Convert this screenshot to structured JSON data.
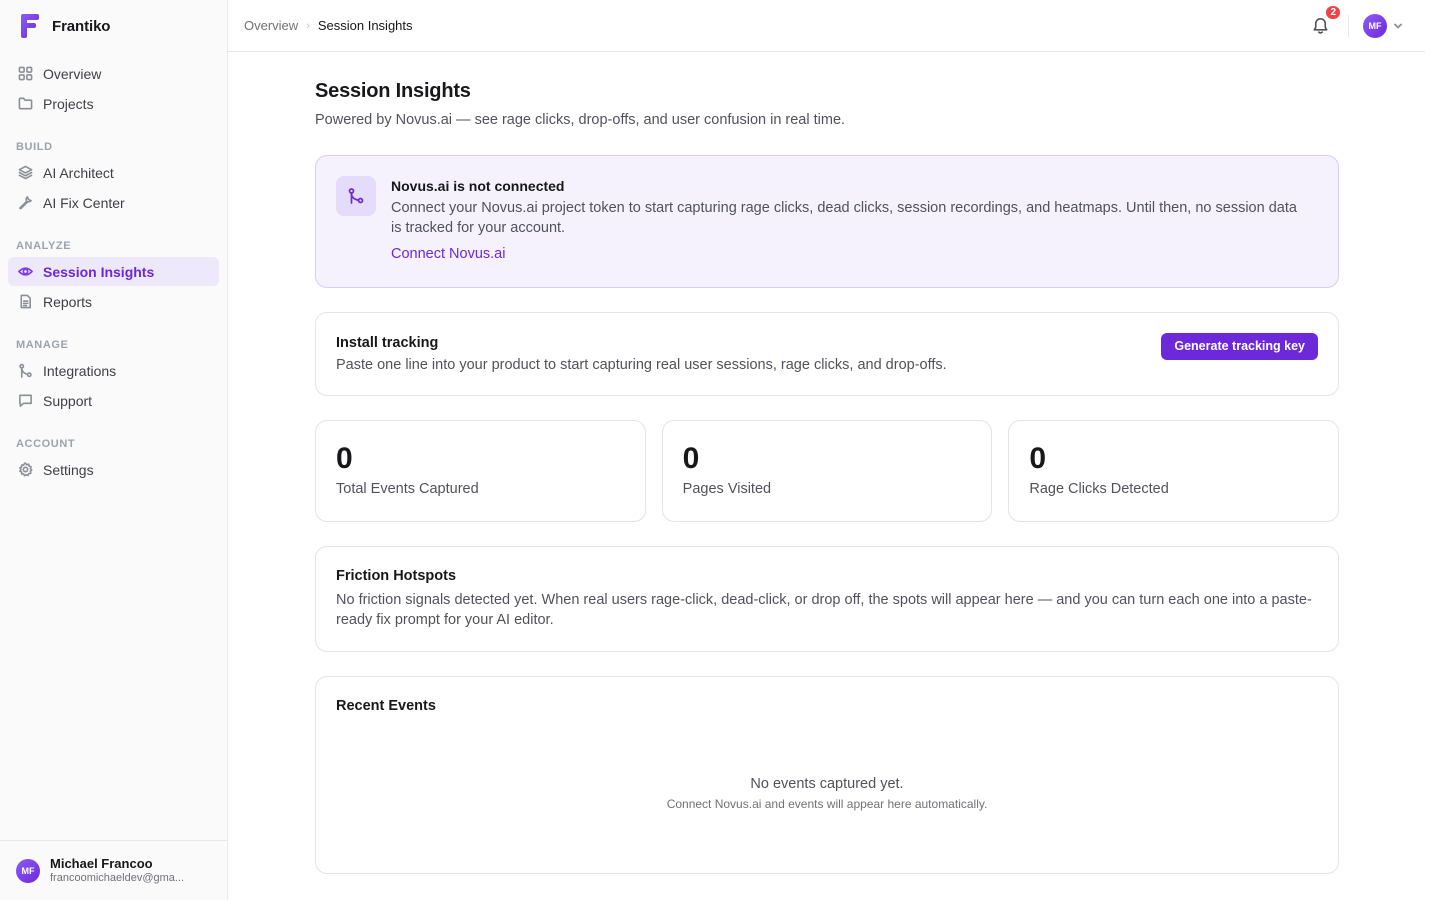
{
  "brand": {
    "name": "Frantiko",
    "logo_color": "#6d28d9"
  },
  "sidebar": {
    "top_items": [
      {
        "label": "Overview",
        "icon": "grid-icon"
      },
      {
        "label": "Projects",
        "icon": "folder-icon"
      }
    ],
    "sections": [
      {
        "label": "BUILD",
        "items": [
          {
            "label": "AI Architect",
            "icon": "layers-icon"
          },
          {
            "label": "AI Fix Center",
            "icon": "wrench-icon"
          }
        ]
      },
      {
        "label": "ANALYZE",
        "items": [
          {
            "label": "Session Insights",
            "icon": "eye-icon",
            "active": true
          },
          {
            "label": "Reports",
            "icon": "document-icon"
          }
        ]
      },
      {
        "label": "MANAGE",
        "items": [
          {
            "label": "Integrations",
            "icon": "git-merge-icon"
          },
          {
            "label": "Support",
            "icon": "chat-icon"
          }
        ]
      },
      {
        "label": "ACCOUNT",
        "items": [
          {
            "label": "Settings",
            "icon": "gear-icon"
          }
        ]
      }
    ],
    "user": {
      "initials": "MF",
      "name": "Michael Francoo",
      "email": "francoomichaeldev@gma..."
    }
  },
  "topbar": {
    "breadcrumb": [
      "Overview",
      "Session Insights"
    ],
    "notifications_count": "2",
    "avatar_initials": "MF"
  },
  "page": {
    "title": "Session Insights",
    "subtitle": "Powered by Novus.ai — see rage clicks, drop-offs, and user confusion in real time."
  },
  "alert": {
    "title": "Novus.ai is not connected",
    "text": "Connect your Novus.ai project token to start capturing rage clicks, dead clicks, session recordings, and heatmaps. Until then, no session data is tracked for your account.",
    "link": "Connect Novus.ai"
  },
  "install": {
    "title": "Install tracking",
    "text": "Paste one line into your product to start capturing real user sessions, rage clicks, and drop-offs.",
    "button": "Generate tracking key"
  },
  "stats": [
    {
      "value": "0",
      "label": "Total Events Captured"
    },
    {
      "value": "0",
      "label": "Pages Visited"
    },
    {
      "value": "0",
      "label": "Rage Clicks Detected"
    }
  ],
  "friction": {
    "title": "Friction Hotspots",
    "text": "No friction signals detected yet. When real users rage-click, dead-click, or drop off, the spots will appear here — and you can turn each one into a paste-ready fix prompt for your AI editor."
  },
  "recent": {
    "title": "Recent Events",
    "empty_title": "No events captured yet.",
    "empty_sub": "Connect Novus.ai and events will appear here automatically."
  },
  "colors": {
    "accent": "#6d28d9",
    "active_bg": "#ede9fb",
    "alert_bg": "#f5f2fd",
    "badge": "#ef4444"
  }
}
